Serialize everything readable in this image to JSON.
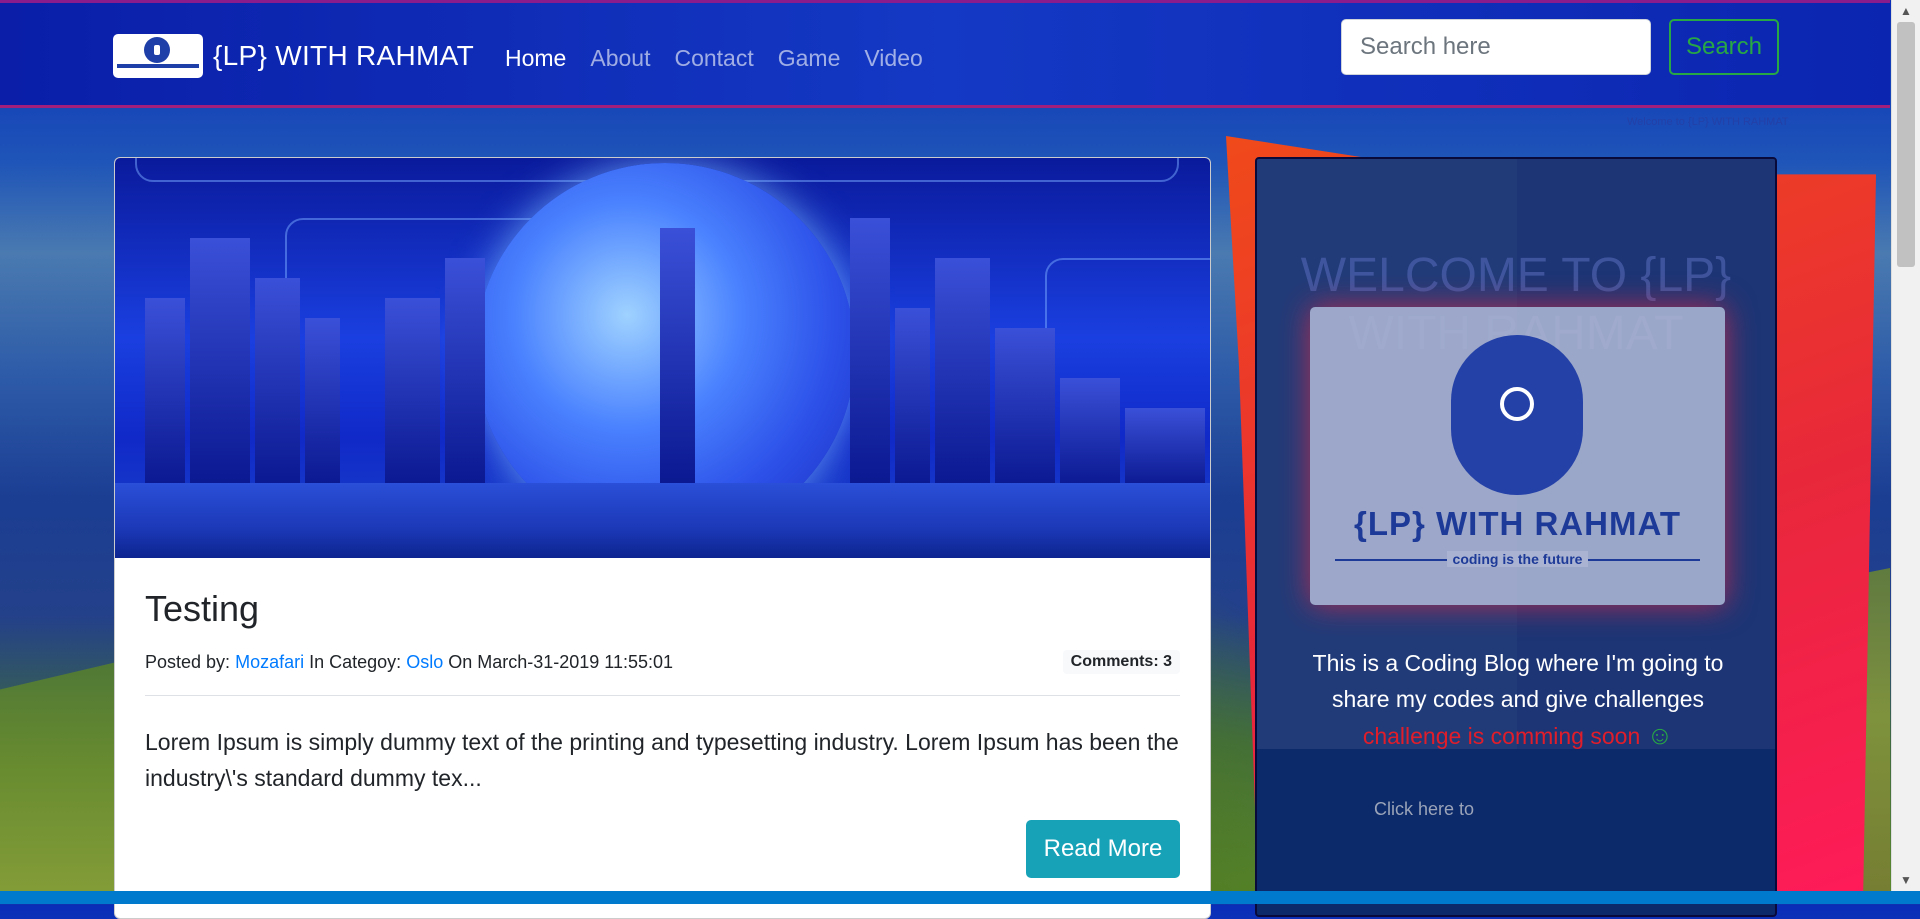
{
  "navbar": {
    "brand_name": "{LP} WITH RAHMAT",
    "items": [
      {
        "label": "Home",
        "active": true
      },
      {
        "label": "About"
      },
      {
        "label": "Contact"
      },
      {
        "label": "Game"
      },
      {
        "label": "Video"
      }
    ],
    "search_placeholder": "Search here",
    "search_button": "Search"
  },
  "welcome_mini": "Welcome to {LP} WITH RAHMAT",
  "post": {
    "title": "Testing",
    "posted_by_label": "Posted by:",
    "author": "Mozafari",
    "category_label": "In Categoy:",
    "category": "Oslo",
    "date_text": "On March-31-2019 11:55:01",
    "comments": "Comments: 3",
    "excerpt": "Lorem Ipsum is simply dummy text of the printing and typesetting industry. Lorem Ipsum has been the industry\\'s standard dummy tex...",
    "read_more": "Read More"
  },
  "sidebar": {
    "title": "WELCOME TO {LP} WITH RAHMAT",
    "logo_name": "{LP} WITH RAHMAT",
    "logo_tagline": "coding is the future",
    "description": "This is a Coding Blog where I'm going to share my codes and give challenges",
    "challenge": "challenge is comming soon",
    "smile": "☺",
    "click_text": "Click here to"
  },
  "colors": {
    "navbar_bg": "#1439c4",
    "search_btn": "#28a745",
    "read_more_btn": "#17a2b8",
    "link": "#007bff",
    "sidebar_bg": "#0c2a6a",
    "challenge_text": "#e11d2a"
  }
}
